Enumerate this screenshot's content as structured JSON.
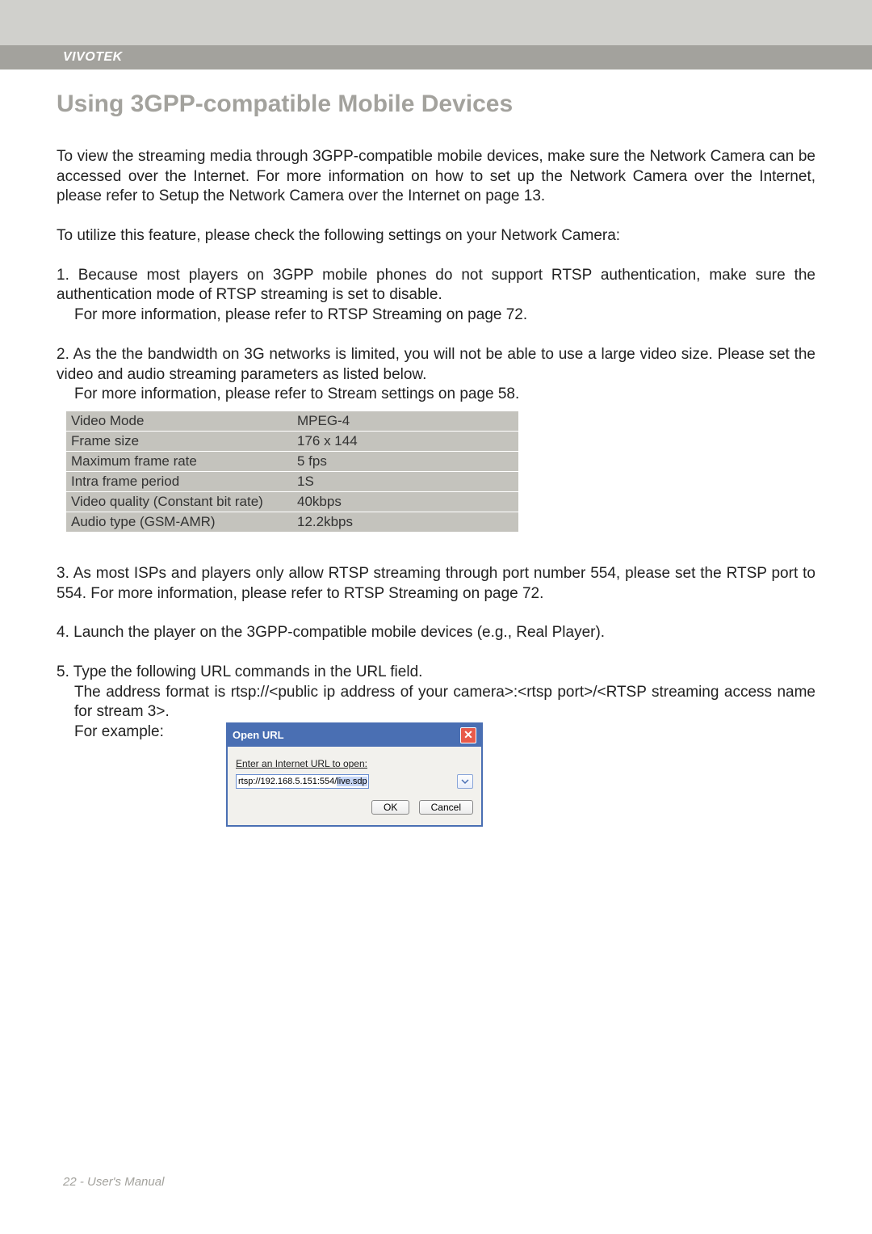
{
  "brand": "VIVOTEK",
  "title": "Using 3GPP-compatible Mobile Devices",
  "intro1": "To view the streaming media through 3GPP-compatible mobile devices, make sure the Network Camera can be accessed over the Internet. For more information on how to set up the Network Camera over the Internet, please refer to Setup the Network Camera over the Internet on page 13.",
  "intro2": "To utilize this feature, please check the following settings on your Network Camera:",
  "step1_line1": "1. Because most players on 3GPP mobile phones do not support RTSP authentication, make sure the authentication mode of RTSP streaming is set to disable.",
  "step1_line2": "For more information, please refer to RTSP Streaming on page 72.",
  "step2_line1": "2. As the the bandwidth on 3G networks is limited, you will not be able to use a large video size. Please set the video and audio streaming parameters as listed below.",
  "step2_line2": "For more information, please refer to Stream settings on page 58.",
  "settings_rows": [
    {
      "label": "Video Mode",
      "value": "MPEG-4"
    },
    {
      "label": "Frame size",
      "value": "176 x 144"
    },
    {
      "label": "Maximum frame rate",
      "value": "5 fps"
    },
    {
      "label": "Intra frame period",
      "value": "1S"
    },
    {
      "label": "Video quality (Constant bit rate)",
      "value": "40kbps"
    },
    {
      "label": "Audio type (GSM-AMR)",
      "value": "12.2kbps"
    }
  ],
  "step3": "3. As most ISPs and players only allow RTSP streaming through port number 554, please set the RTSP port to 554. For more information, please refer to RTSP Streaming on page 72.",
  "step4": "4. Launch the player on the 3GPP-compatible mobile devices (e.g., Real Player).",
  "step5_line1": "5. Type the following URL commands in the URL field.",
  "step5_line2": "The address format is rtsp://<public ip address of your camera>:<rtsp port>/<RTSP streaming access name for stream 3>.",
  "step5_example": "For example:",
  "dialog": {
    "title": "Open URL",
    "prompt": "Enter an Internet URL to open:",
    "url_prefix": "rtsp://192.168.5.151:554/",
    "url_highlight": "live.sdp",
    "ok": "OK",
    "cancel": "Cancel"
  },
  "footer": "22 - User's Manual"
}
